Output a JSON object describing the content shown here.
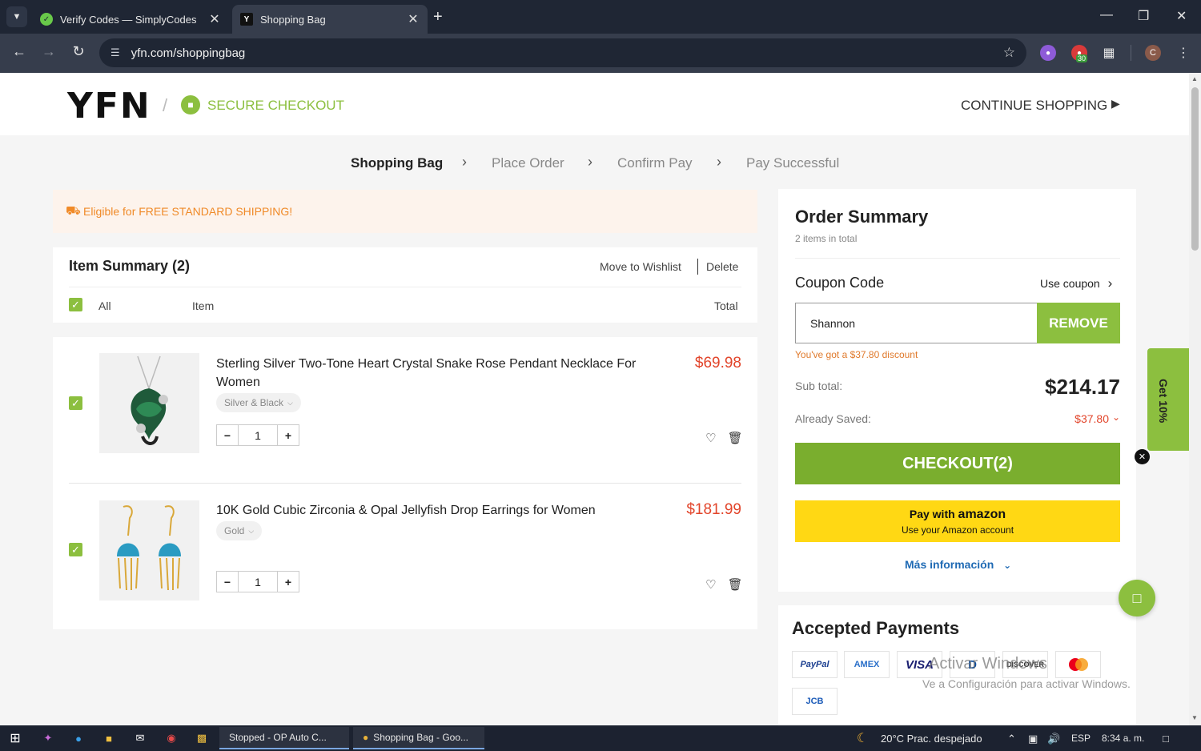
{
  "browser": {
    "tabs": [
      {
        "title": "Verify Codes — SimplyCodes",
        "icon": "simplycodes-icon"
      },
      {
        "title": "Shopping Bag",
        "icon": "yfn-icon"
      }
    ],
    "url": "yfn.com/shoppingbag",
    "extension_badge": "30",
    "profile_initial": "C"
  },
  "header": {
    "logo": "YFN",
    "secure_checkout": "SECURE CHECKOUT",
    "continue_shopping": "CONTINUE SHOPPING"
  },
  "steps": [
    "Shopping Bag",
    "Place Order",
    "Confirm Pay",
    "Pay Successful"
  ],
  "shipping_banner": "Eligible for FREE STANDARD SHIPPING!",
  "item_summary": {
    "title": "Item Summary (2)",
    "move_to_wishlist": "Move to Wishlist",
    "delete": "Delete",
    "col_all": "All",
    "col_item": "Item",
    "col_total": "Total"
  },
  "products": [
    {
      "name": "Sterling Silver Two-Tone Heart Crystal Snake Rose Pendant Necklace For Women",
      "price": "$69.98",
      "variant": "Silver & Black",
      "quantity": "1"
    },
    {
      "name": "10K Gold Cubic Zirconia & Opal Jellyfish Drop Earrings for Women",
      "price": "$181.99",
      "variant": "Gold",
      "quantity": "1"
    }
  ],
  "summary": {
    "title": "Order Summary",
    "items_total": "2 items in total",
    "coupon_label": "Coupon Code",
    "use_coupon": "Use coupon",
    "coupon_value": "Shannon",
    "remove": "REMOVE",
    "discount_note": "You've got a $37.80 discount",
    "subtotal_label": "Sub total:",
    "subtotal_value": "$214.17",
    "saved_label": "Already Saved:",
    "saved_value": "$37.80",
    "checkout": "CHECKOUT(2)",
    "amazon_line1_pre": "Pay with",
    "amazon_brand": "amazon",
    "amazon_line2": "Use your Amazon account",
    "more_info": "Más información"
  },
  "payments": {
    "title": "Accepted Payments",
    "logos": [
      "PayPal",
      "AMEX",
      "VISA",
      "D",
      "DISCOVER",
      "",
      "JCB"
    ]
  },
  "floating": {
    "promo": "Get 10%"
  },
  "watermark": {
    "line1": "Activar Windows",
    "line2": "Ve a Configuración para activar Windows."
  },
  "taskbar": {
    "apps": [
      "Stopped - OP Auto C...",
      "Shopping Bag - Goo..."
    ],
    "weather": "20°C  Prac. despejado",
    "lang": "ESP",
    "time": "8:34 a. m."
  },
  "colors": {
    "brand_green": "#8cbf3f",
    "price_red": "#e2452b",
    "amazon_yellow": "#ffd814",
    "link_blue": "#1f6ab4"
  }
}
